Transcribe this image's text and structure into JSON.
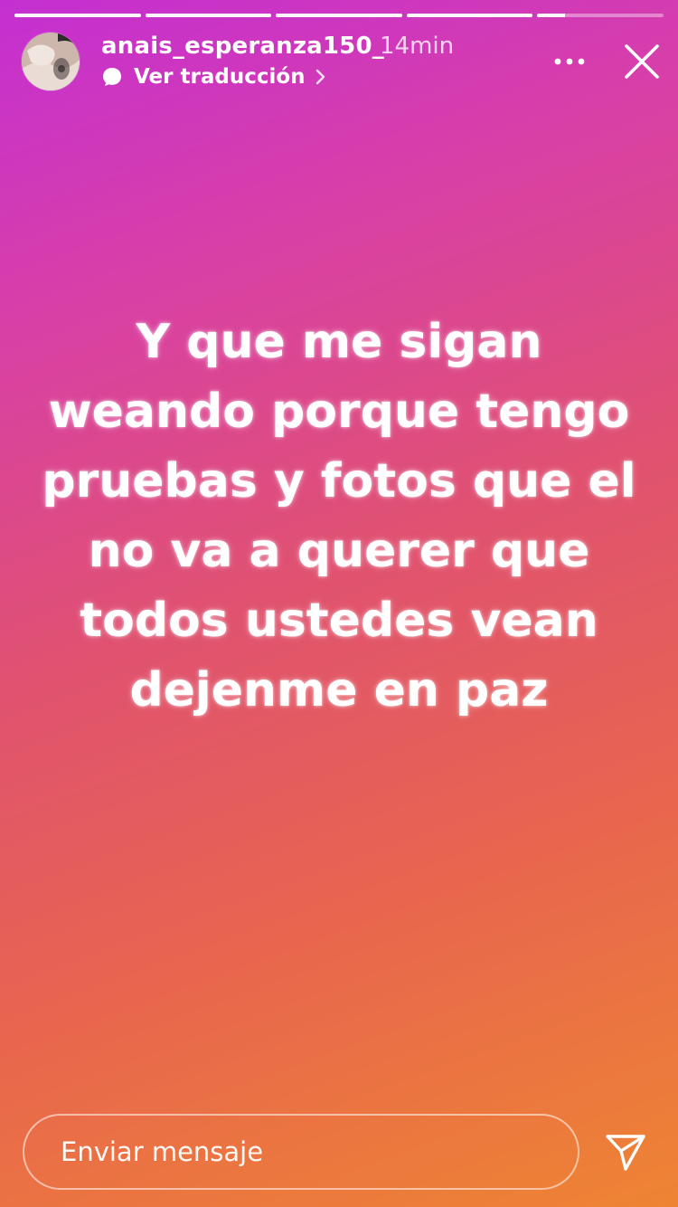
{
  "story": {
    "segments": [
      {
        "progress": 1.0
      },
      {
        "progress": 1.0
      },
      {
        "progress": 1.0
      },
      {
        "progress": 1.0
      },
      {
        "progress": 0.22
      }
    ],
    "gradient_colors": [
      "#c42fd2",
      "#e0526f",
      "#ee8433"
    ]
  },
  "header": {
    "username": "anais_esperanza150_",
    "timestamp": "14min",
    "translate_label": "Ver traducción",
    "avatar_icon": "profile-photo",
    "more_icon": "more-options-icon",
    "close_icon": "close-icon"
  },
  "content": {
    "text": "Y que me sigan\nweando porque tengo\npruebas y fotos que el\nno va a querer que\ntodos ustedes vean\ndejenme en paz"
  },
  "footer": {
    "message_placeholder": "Enviar mensaje",
    "send_icon": "send-icon"
  }
}
